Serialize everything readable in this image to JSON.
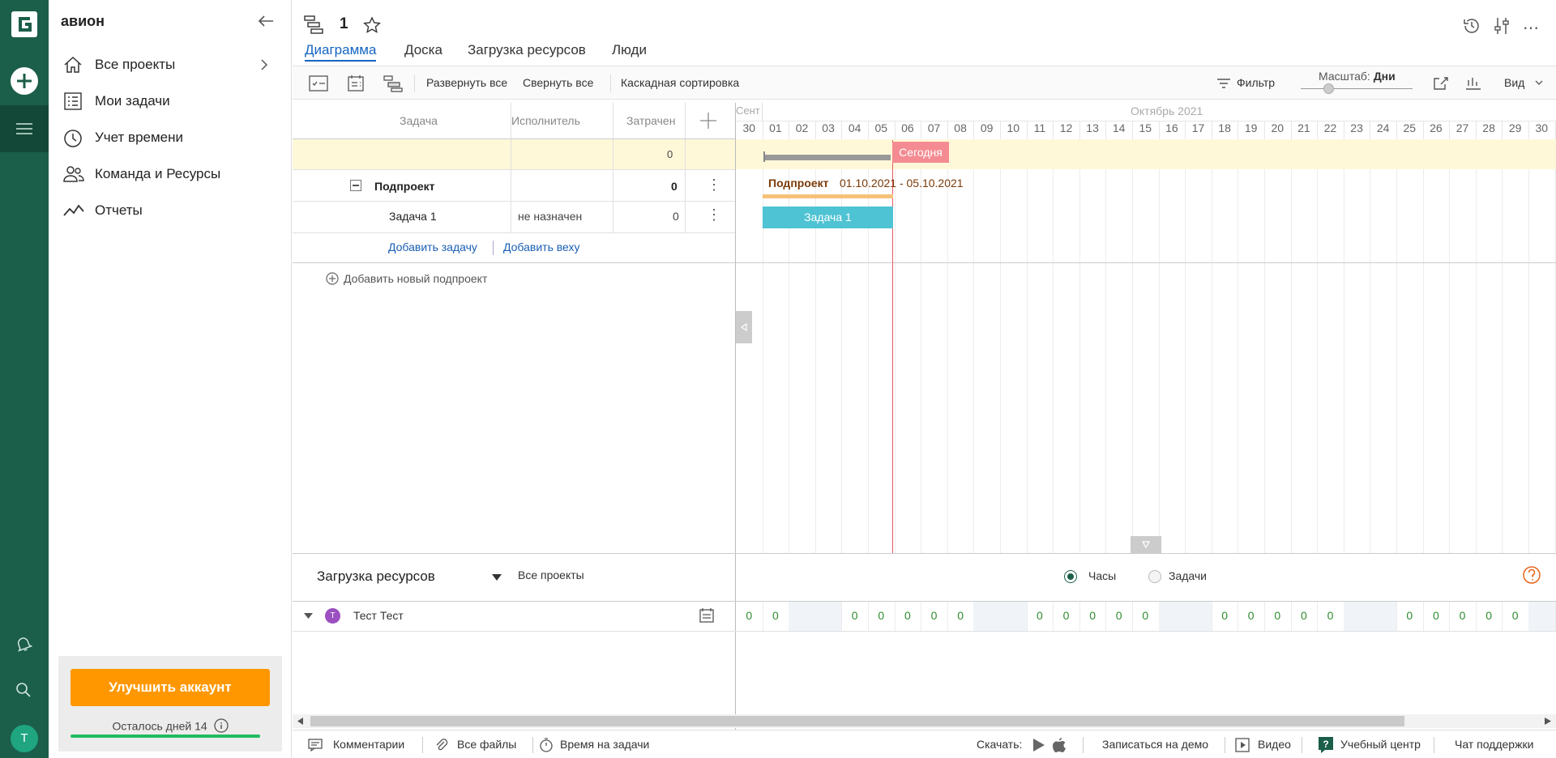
{
  "sidebar": {
    "title": "авион",
    "items": [
      {
        "label": "Все проекты"
      },
      {
        "label": "Мои задачи"
      },
      {
        "label": "Учет времени"
      },
      {
        "label": "Команда и Ресурсы"
      },
      {
        "label": "Отчеты"
      }
    ],
    "upgrade_label": "Улучшить аккаунт",
    "days_left": "Осталось дней 14",
    "trial_progress": 0.95,
    "avatar_initial": "T"
  },
  "header": {
    "project_name": "1",
    "tabs": [
      {
        "label": "Диаграмма",
        "active": true
      },
      {
        "label": "Доска",
        "active": false
      },
      {
        "label": "Загрузка ресурсов",
        "active": false
      },
      {
        "label": "Люди",
        "active": false
      }
    ]
  },
  "toolbar": {
    "expand_all": "Развернуть все",
    "collapse_all": "Свернуть все",
    "cascade_sort": "Каскадная сортировка",
    "filter": "Фильтр",
    "scale_label": "Масштаб:",
    "scale_value": "Дни",
    "view": "Вид"
  },
  "grid": {
    "columns": [
      "Задача",
      "Исполнитель",
      "Затрачен"
    ],
    "summary_spent": "0",
    "subproject": {
      "name": "Подпроект",
      "spent": "0"
    },
    "task": {
      "name": "Задача 1",
      "assignee": "не назначен",
      "spent": "0"
    },
    "add_task": "Добавить задачу",
    "add_milestone": "Добавить веху",
    "add_subproject": "Добавить новый подпроект"
  },
  "gantt": {
    "month_prev": "Сент",
    "month": "Октябрь 2021",
    "days": [
      "30",
      "01",
      "02",
      "03",
      "04",
      "05",
      "06",
      "07",
      "08",
      "09",
      "10",
      "11",
      "12",
      "13",
      "14",
      "15",
      "16",
      "17",
      "18",
      "19",
      "20",
      "21",
      "22",
      "23",
      "24",
      "25",
      "26",
      "27",
      "28",
      "29",
      "30"
    ],
    "today_label": "Сегодня",
    "subproject_label": "Подпроект",
    "subproject_range": "01.10.2021 - 05.10.2021",
    "task_bar_label": "Задача 1",
    "colors": {
      "today": "#f48b92",
      "task": "#4ec3d3",
      "summary": "#f6c27a",
      "highlight": "#fff8d8"
    }
  },
  "resources": {
    "title": "Загрузка ресурсов",
    "filter": "Все проекты",
    "mode_hours": "Часы",
    "mode_tasks": "Задачи",
    "person": "Тест Тест",
    "person_initial": "Т",
    "loads": [
      "0",
      "0",
      "",
      "",
      "0",
      "0",
      "0",
      "0",
      "0",
      "",
      "",
      "0",
      "0",
      "0",
      "0",
      "0",
      "",
      "",
      "0",
      "0",
      "0",
      "0",
      "0",
      "",
      "",
      "0",
      "0",
      "0",
      "0",
      "0",
      ""
    ]
  },
  "footer": {
    "comments": "Комментарии",
    "files": "Все файлы",
    "time": "Время на задачи",
    "download": "Скачать:",
    "demo": "Записаться на демо",
    "video": "Видео",
    "learn": "Учебный центр",
    "support": "Чат поддержки"
  }
}
